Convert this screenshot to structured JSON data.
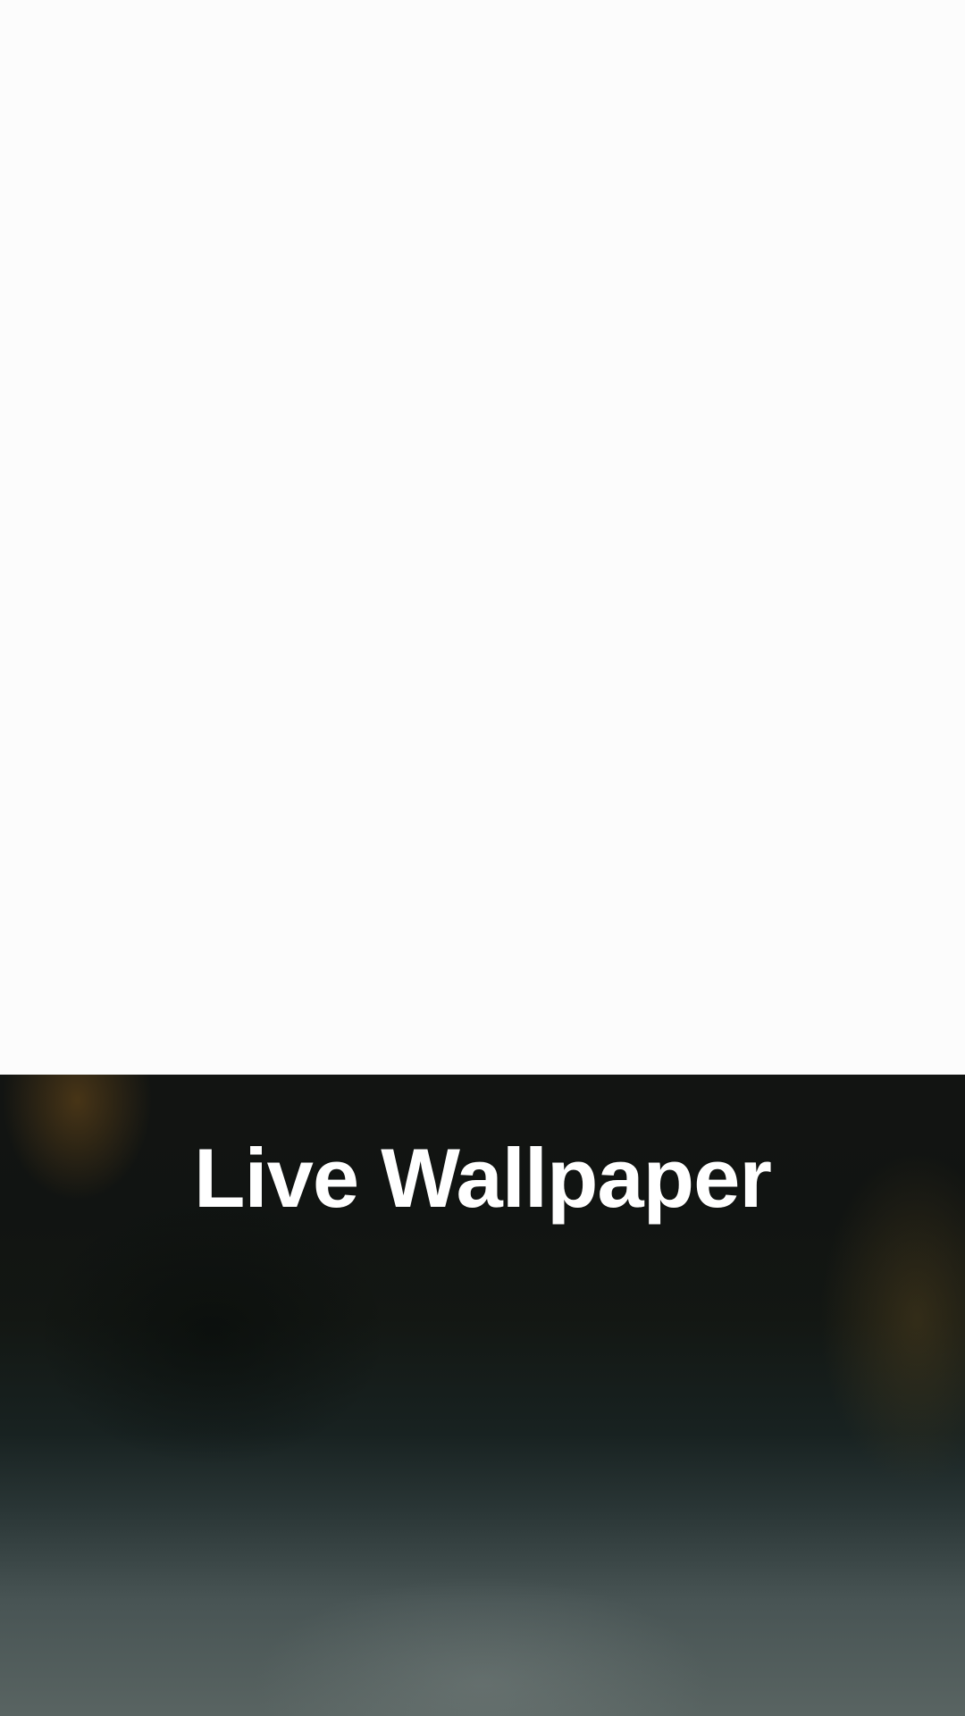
{
  "wallpaper_preview": {
    "title": "Live Wallpaper",
    "colors": {
      "top_background": "#fcfcfc",
      "panel_dark": "#121412",
      "panel_mid": "#182221",
      "panel_bottom": "#596462",
      "title_text": "#ffffff"
    }
  }
}
